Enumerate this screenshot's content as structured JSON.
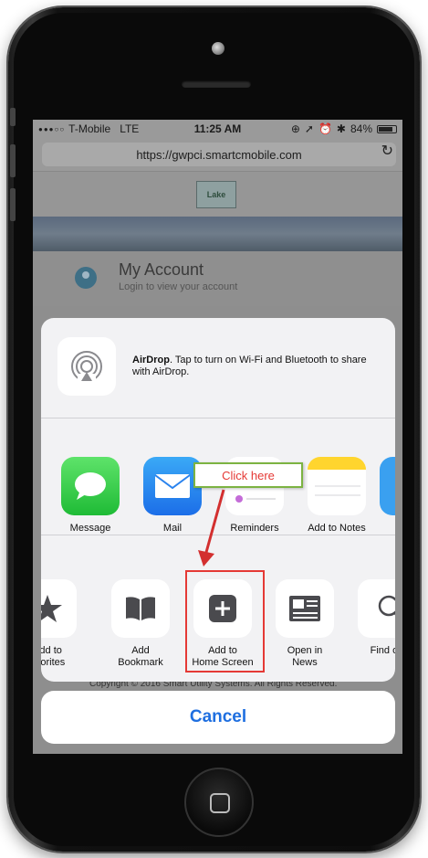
{
  "status_bar": {
    "carrier": "T-Mobile",
    "network": "LTE",
    "time": "11:25 AM",
    "battery": "84%"
  },
  "browser": {
    "url": "https://gwpci.smartcmobile.com",
    "reload_icon": "reload-icon"
  },
  "site": {
    "logo_text": "Lake Wales",
    "account_title": "My Account",
    "account_subtitle": "Login to view your account",
    "footer": "Copyright © 2016 Smart Utility Systems. All Rights Reserved."
  },
  "share_sheet": {
    "airdrop_bold": "AirDrop",
    "airdrop_text": ". Tap to turn on Wi-Fi and Bluetooth to share with AirDrop.",
    "apps": [
      {
        "label": "Message",
        "icon": "message-icon"
      },
      {
        "label": "Mail",
        "icon": "mail-icon"
      },
      {
        "label": "Reminders",
        "icon": "reminders-icon"
      },
      {
        "label": "Add to Notes",
        "icon": "notes-icon"
      }
    ],
    "actions": [
      {
        "label": "Add to Favorites",
        "display": "Add to\navorites",
        "icon": "star-icon"
      },
      {
        "label": "Add Bookmark",
        "display": "Add\nBookmark",
        "icon": "book-icon"
      },
      {
        "label": "Add to Home Screen",
        "display": "Add to\nHome Screen",
        "icon": "plus-icon"
      },
      {
        "label": "Open in News",
        "display": "Open in\nNews",
        "icon": "news-icon"
      },
      {
        "label": "Find on Page",
        "display": "Find on",
        "icon": "search-icon"
      }
    ],
    "cancel_label": "Cancel"
  },
  "annotation": {
    "callout_text": "Click here",
    "highlight_color": "#e53935",
    "callout_border": "#7cb342"
  }
}
